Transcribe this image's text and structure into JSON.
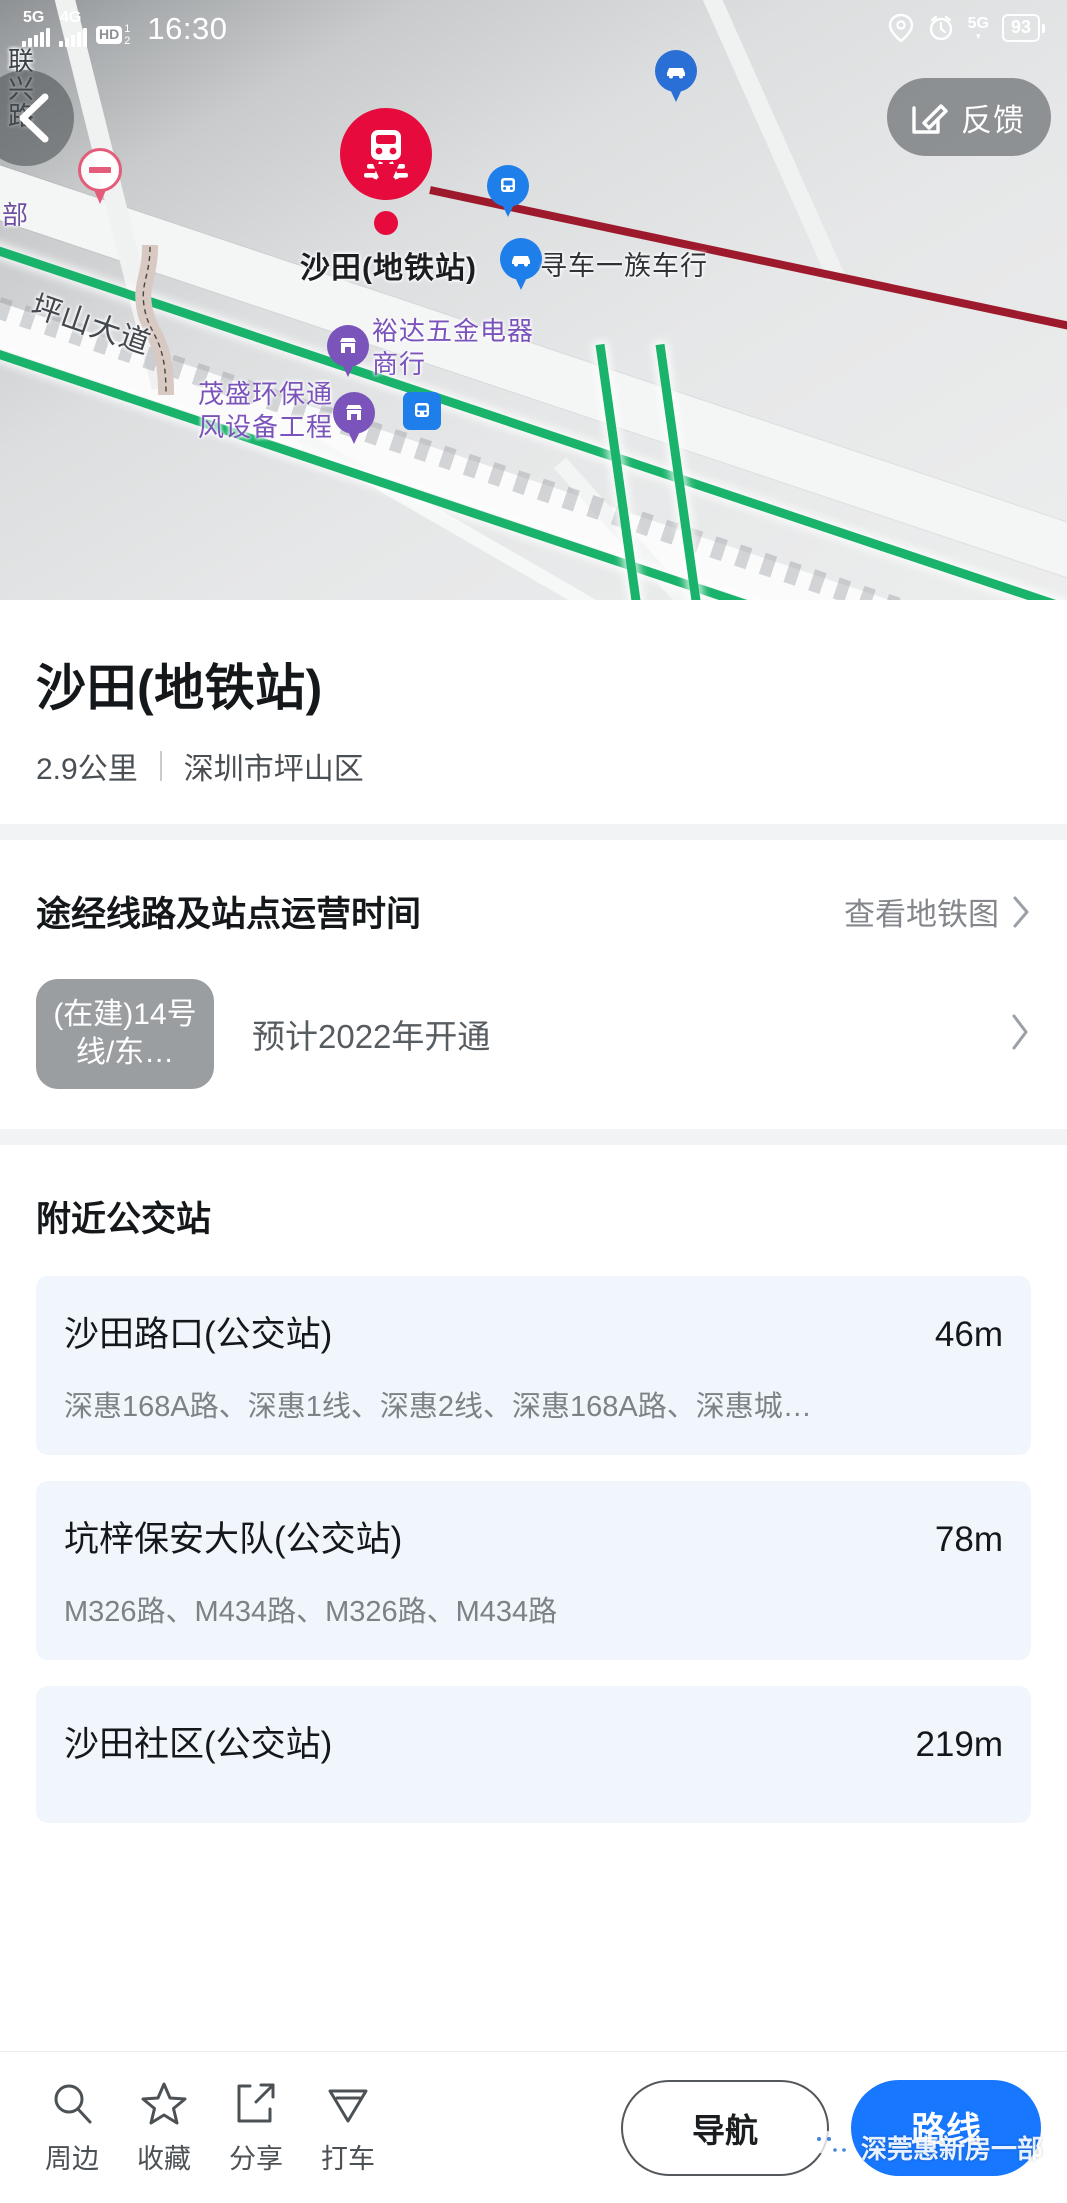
{
  "status_bar": {
    "sim1_network": "5G",
    "sim2_network": "4G",
    "hd_label": "HD",
    "hd_sim1": "1",
    "hd_sim2": "2",
    "time": "16:30",
    "right_network": "5G",
    "battery_level": "93"
  },
  "map": {
    "back_icon": "chevron-left-icon",
    "feedback_label": "反馈",
    "feedback_icon": "edit-pencil-icon",
    "labels": {
      "road_lianxing": "联兴路",
      "fragment_bu": "部",
      "road_pingshan": "坪山大道",
      "station": "沙田(地铁站)",
      "bike_shop": "寻车一族车行",
      "hardware_shop": "裕达五金电器商行",
      "env_company": "茂盛环保通风设备工程"
    },
    "colors": {
      "metro_pin": "#e60b3c",
      "metro_line_green": "#19b36b",
      "metro_line_red": "#9d1a2c",
      "poi_purple": "#7a54bb",
      "poi_blue": "#1f7fea"
    }
  },
  "poi": {
    "title": "沙田(地铁站)",
    "distance": "2.9公里",
    "district": "深圳市坪山区"
  },
  "lines_section": {
    "title": "途经线路及站点运营时间",
    "link_label": "查看地铁图",
    "link_icon": "chevron-right-icon",
    "rows": [
      {
        "badge": "(在建)14号线/东…",
        "status": "预计2022年开通",
        "arrow_icon": "chevron-right-icon"
      }
    ]
  },
  "bus_section": {
    "title": "附近公交站",
    "stations": [
      {
        "name": "沙田路口(公交站)",
        "distance": "46m",
        "routes": "深惠168A路、深惠1线、深惠2线、深惠168A路、深惠城…"
      },
      {
        "name": "坑梓保安大队(公交站)",
        "distance": "78m",
        "routes": "M326路、M434路、M326路、M434路"
      },
      {
        "name": "沙田社区(公交站)",
        "distance": "219m",
        "routes": ""
      }
    ]
  },
  "bottom_bar": {
    "items": [
      {
        "label": "周边",
        "icon": "search-icon"
      },
      {
        "label": "收藏",
        "icon": "star-icon"
      },
      {
        "label": "分享",
        "icon": "share-icon"
      },
      {
        "label": "打车",
        "icon": "taxi-pin-icon"
      }
    ],
    "nav_button": "导航",
    "route_button": "路线",
    "route_button_color": "#1777ff"
  },
  "watermark": {
    "text": "深莞惠新房一部",
    "icon": "wechat-icon"
  }
}
